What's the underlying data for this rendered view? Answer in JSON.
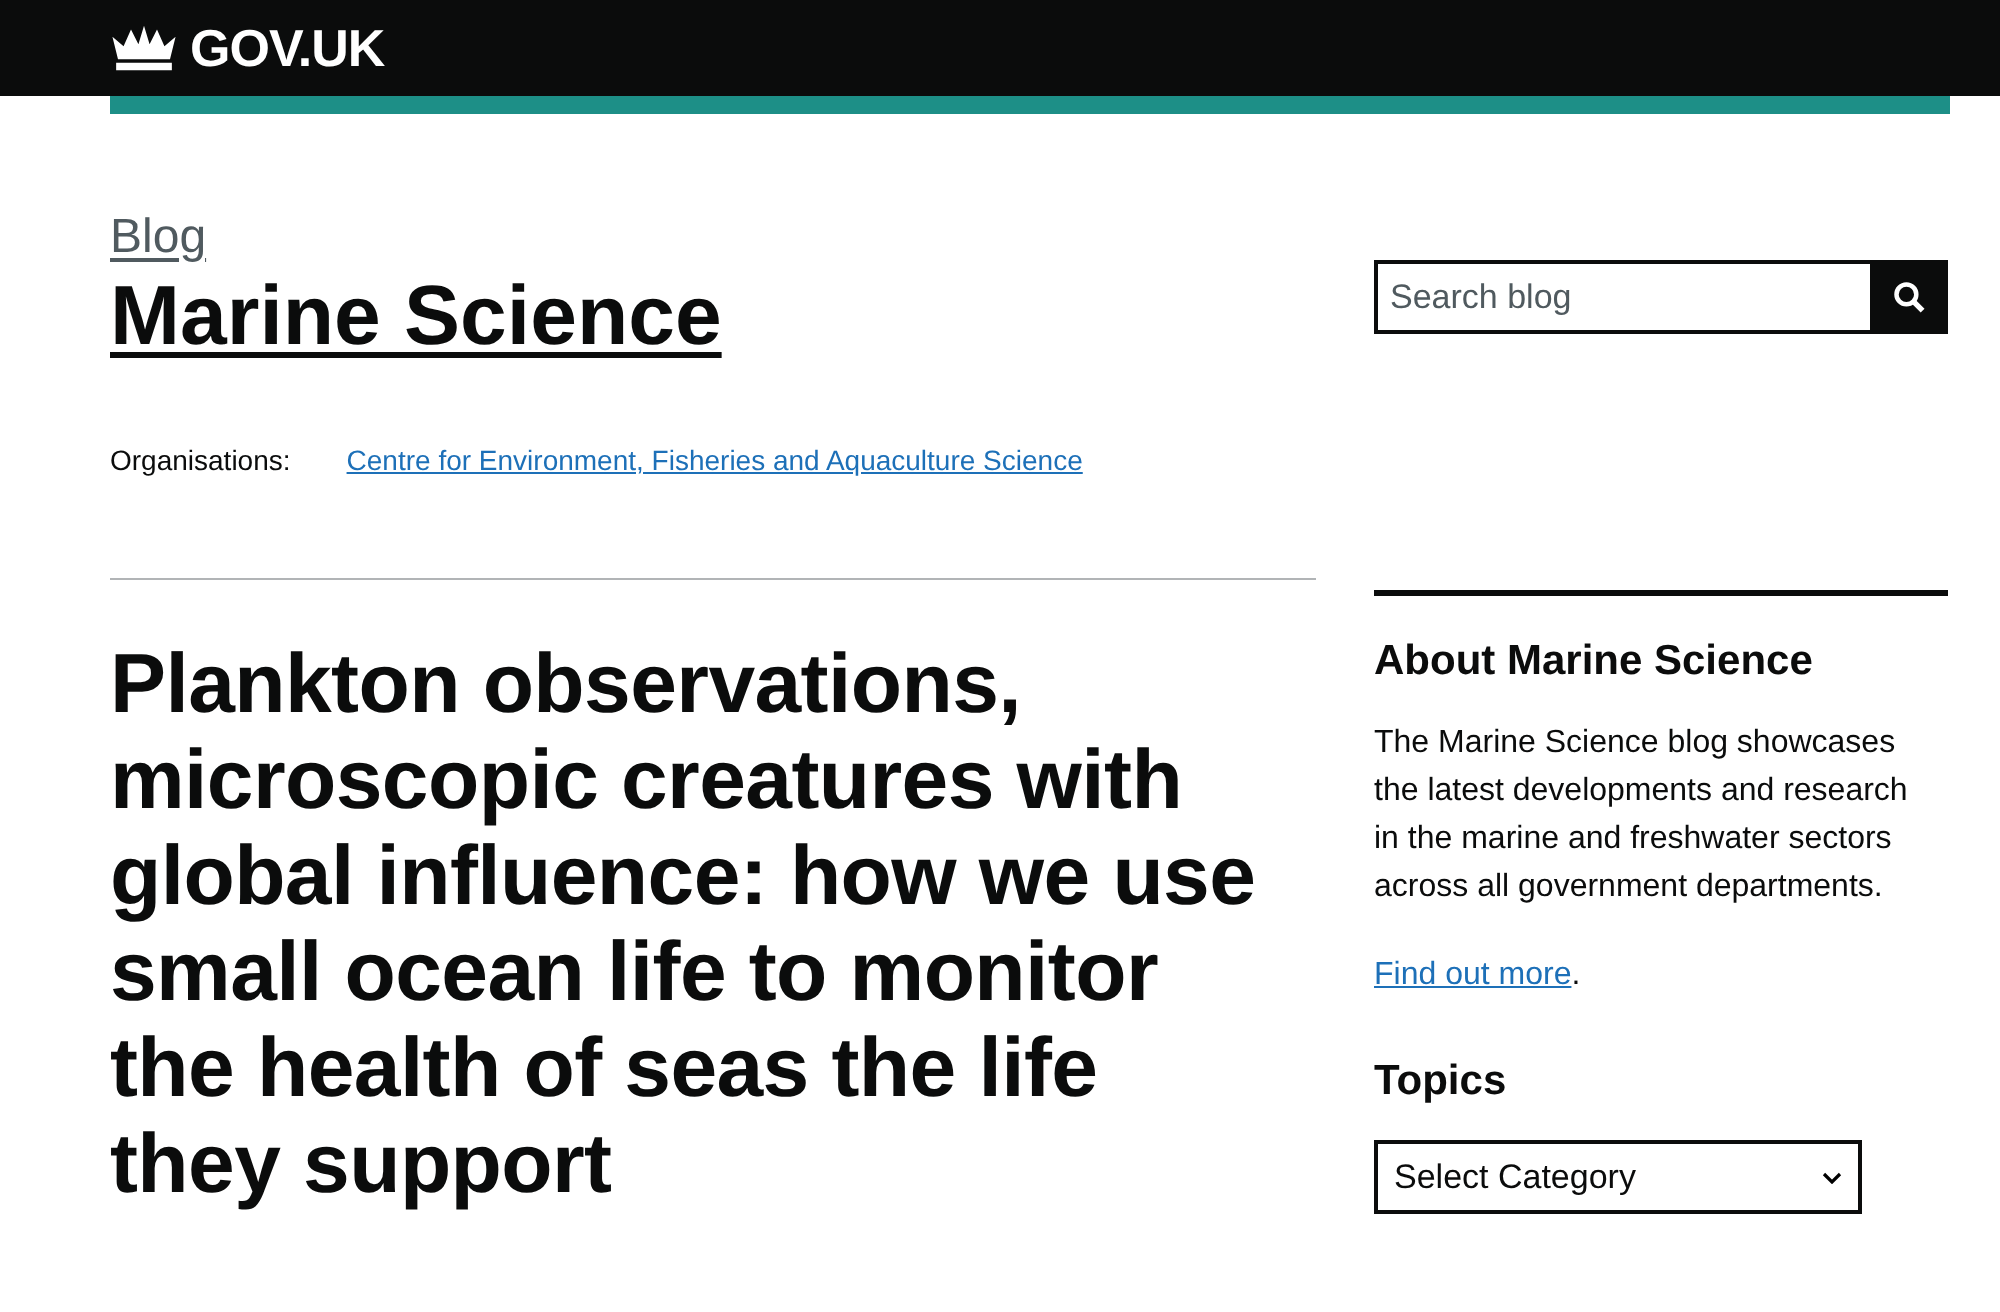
{
  "header": {
    "logo": "GOV.UK"
  },
  "blog": {
    "label": "Blog",
    "title": "Marine Science"
  },
  "organisations": {
    "label": "Organisations:",
    "link": "Centre for Environment, Fisheries and Aquaculture Science"
  },
  "search": {
    "placeholder": "Search blog"
  },
  "article": {
    "title": "Plankton observations, microscopic creatures with global influence: how we use small ocean life to monitor the health of seas the life they support"
  },
  "about": {
    "heading": "About Marine Science",
    "text": "The Marine Science blog showcases the latest developments and research in the marine and freshwater sectors across all government departments.",
    "link": "Find out more",
    "link_suffix": "."
  },
  "topics": {
    "heading": "Topics",
    "select": "Select Category"
  }
}
